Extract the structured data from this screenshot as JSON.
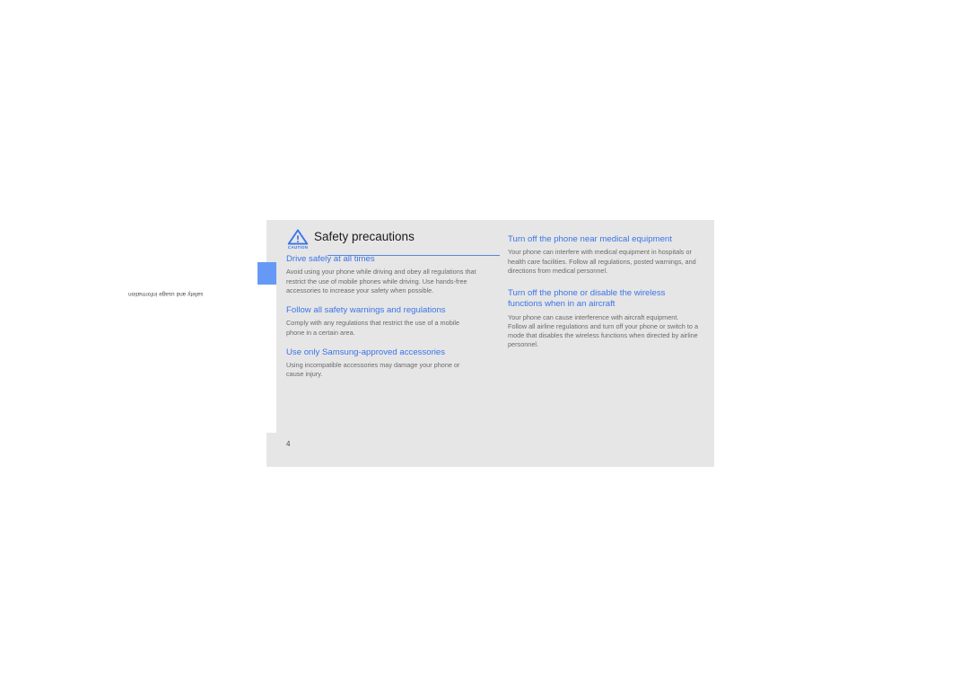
{
  "document": {
    "page_number": "4",
    "side_tab_label": "safety and usage information",
    "accent_color": "#3b74e8",
    "tab_color": "#6699f5",
    "panel_color": "#e6e6e6",
    "body_text_color": "#6b6b6b"
  },
  "chapter": {
    "icon_name": "caution-triangle-icon",
    "icon_caption": "CAUTION",
    "title": "Safety precautions"
  },
  "columns": {
    "left": [
      {
        "heading": "Drive safely at all times",
        "body": "Avoid using your phone while driving and obey all regulations that restrict the use of mobile phones while driving. Use hands-free accessories to increase your safety when possible."
      },
      {
        "heading": "Follow all safety warnings and regulations",
        "body": "Comply with any regulations that restrict the use of a mobile phone in a certain area."
      },
      {
        "heading": "Use only Samsung-approved accessories",
        "body": "Using incompatible accessories may damage your phone or cause injury."
      }
    ],
    "right": [
      {
        "heading": "Turn off the phone near medical equipment",
        "body": "Your phone can interfere with medical equipment in hospitals or health care facilities. Follow all regulations, posted warnings, and directions from medical personnel."
      },
      {
        "heading": "Turn off the phone or disable the wireless functions when in an aircraft",
        "body": "Your phone can cause interference with aircraft equipment. Follow all airline regulations and turn off your phone or switch to a mode that disables the wireless functions when directed by airline personnel."
      }
    ]
  }
}
